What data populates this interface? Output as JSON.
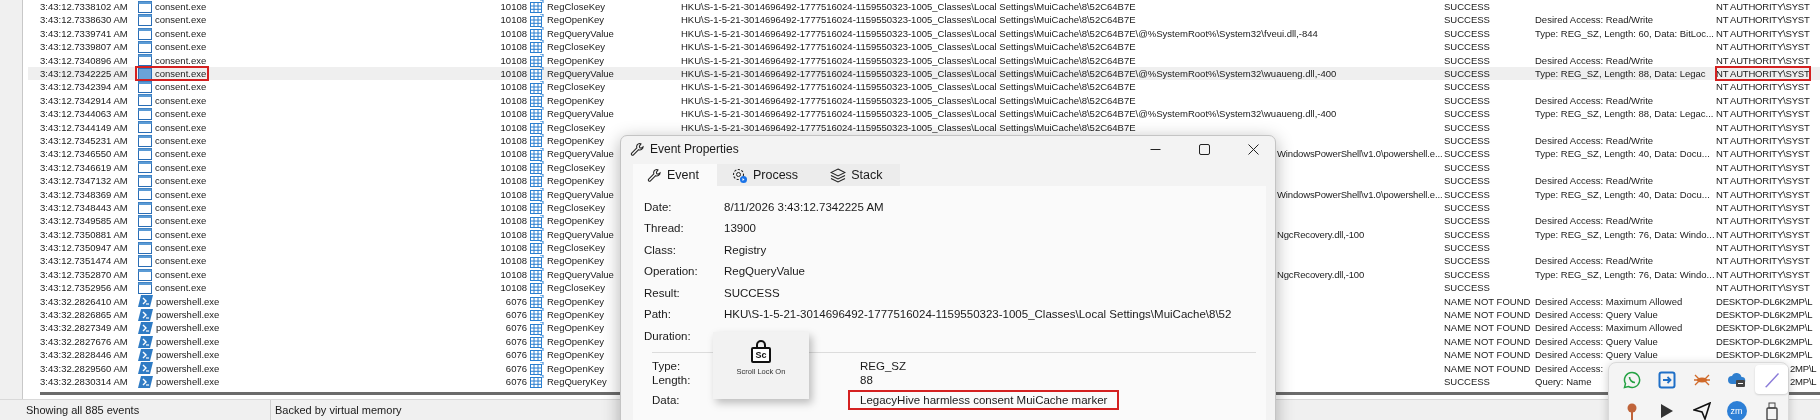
{
  "rows": [
    {
      "time": "3:43:12.7338102 AM",
      "kind": "gui",
      "process": "consent.exe",
      "pid": "10108",
      "operation": "RegCloseKey",
      "path": "HKU\\S-1-5-21-3014696492-1777516024-1159550323-1005_Classes\\Local Settings\\MuiCache\\8\\52C64B7E",
      "result": "SUCCESS",
      "user": "NT AUTHORITY\\SYST",
      "selected": false
    },
    {
      "time": "3:43:12.7338630 AM",
      "kind": "gui",
      "process": "consent.exe",
      "pid": "10108",
      "operation": "RegOpenKey",
      "path": "HKU\\S-1-5-21-3014696492-1777516024-1159550323-1005_Classes\\Local Settings\\MuiCache\\8\\52C64B7E",
      "result": "SUCCESS",
      "detail": "Desired Access: Read/Write",
      "user": "NT AUTHORITY\\SYST",
      "selected": false
    },
    {
      "time": "3:43:12.7339741 AM",
      "kind": "gui",
      "process": "consent.exe",
      "pid": "10108",
      "operation": "RegQueryValue",
      "path": "HKU\\S-1-5-21-3014696492-1777516024-1159550323-1005_Classes\\Local Settings\\MuiCache\\8\\52C64B7E\\@%SystemRoot%\\System32\\fveui.dll,-844",
      "result": "SUCCESS",
      "detail": "Type: REG_SZ, Length: 60, Data: BitLoc...",
      "user": "NT AUTHORITY\\SYST",
      "selected": false
    },
    {
      "time": "3:43:12.7339807 AM",
      "kind": "gui",
      "process": "consent.exe",
      "pid": "10108",
      "operation": "RegCloseKey",
      "path": "HKU\\S-1-5-21-3014696492-1777516024-1159550323-1005_Classes\\Local Settings\\MuiCache\\8\\52C64B7E",
      "result": "SUCCESS",
      "user": "NT AUTHORITY\\SYST",
      "selected": false
    },
    {
      "time": "3:43:12.7340896 AM",
      "kind": "gui",
      "process": "consent.exe",
      "pid": "10108",
      "operation": "RegOpenKey",
      "path": "HKU\\S-1-5-21-3014696492-1777516024-1159550323-1005_Classes\\Local Settings\\MuiCache\\8\\52C64B7E",
      "result": "SUCCESS",
      "detail": "Desired Access: Read/Write",
      "user": "NT AUTHORITY\\SYST",
      "selected": false
    },
    {
      "time": "3:43:12.7342225 AM",
      "kind": "gui",
      "process": "consent.exe",
      "pid": "10108",
      "operation": "RegQueryValue",
      "path": "HKU\\S-1-5-21-3014696492-1777516024-1159550323-1005_Classes\\Local Settings\\MuiCache\\8\\52C64B7E\\@%SystemRoot%\\System32\\wuaueng.dll,-400",
      "result": "SUCCESS",
      "detail": "Type: REG_SZ, Length: 88, Data: Legac",
      "user": "NT AUTHORITY\\SYST",
      "selected": true,
      "process_highlighted": true,
      "user_highlighted": true
    },
    {
      "time": "3:43:12.7342394 AM",
      "kind": "gui",
      "process": "consent.exe",
      "pid": "10108",
      "operation": "RegCloseKey",
      "path": "HKU\\S-1-5-21-3014696492-1777516024-1159550323-1005_Classes\\Local Settings\\MuiCache\\8\\52C64B7E",
      "result": "SUCCESS",
      "user": "NT AUTHORITY\\SYST",
      "selected": false
    },
    {
      "time": "3:43:12.7342914 AM",
      "kind": "gui",
      "process": "consent.exe",
      "pid": "10108",
      "operation": "RegOpenKey",
      "path": "HKU\\S-1-5-21-3014696492-1777516024-1159550323-1005_Classes\\Local Settings\\MuiCache\\8\\52C64B7E",
      "result": "SUCCESS",
      "detail": "Desired Access: Read/Write",
      "user": "NT AUTHORITY\\SYST",
      "selected": false
    },
    {
      "time": "3:43:12.7344063 AM",
      "kind": "gui",
      "process": "consent.exe",
      "pid": "10108",
      "operation": "RegQueryValue",
      "path": "HKU\\S-1-5-21-3014696492-1777516024-1159550323-1005_Classes\\Local Settings\\MuiCache\\8\\52C64B7E\\@%SystemRoot%\\System32\\wuaueng.dll,-400",
      "result": "SUCCESS",
      "detail": "Type: REG_SZ, Length: 88, Data: Legac...",
      "user": "NT AUTHORITY\\SYST",
      "selected": false
    },
    {
      "time": "3:43:12.7344149 AM",
      "kind": "gui",
      "process": "consent.exe",
      "pid": "10108",
      "operation": "RegCloseKey",
      "path": "HKU\\S-1-5-21-3014696492-1777516024-1159550323-1005_Classes\\Local Settings\\MuiCache\\8\\52C64B7E",
      "result": "SUCCESS",
      "user": "NT AUTHORITY\\SYST",
      "selected": false
    },
    {
      "time": "3:43:12.7345231 AM",
      "kind": "gui",
      "process": "consent.exe",
      "pid": "10108",
      "operation": "RegOpenKey",
      "result": "SUCCESS",
      "detail": "Desired Access: Read/Write",
      "user": "NT AUTHORITY\\SYST",
      "selected": false
    },
    {
      "time": "3:43:12.7346550 AM",
      "kind": "gui",
      "process": "consent.exe",
      "pid": "10108",
      "operation": "RegQueryValue",
      "path": "WindowsPowerShell\\v1.0\\powershell.e...",
      "result": "SUCCESS",
      "detail": "Type: REG_SZ, Length: 40, Data: Docu...",
      "user": "NT AUTHORITY\\SYST",
      "selected": false
    },
    {
      "time": "3:43:12.7346619 AM",
      "kind": "gui",
      "process": "consent.exe",
      "pid": "10108",
      "operation": "RegCloseKey",
      "result": "SUCCESS",
      "user": "NT AUTHORITY\\SYST",
      "selected": false
    },
    {
      "time": "3:43:12.7347132 AM",
      "kind": "gui",
      "process": "consent.exe",
      "pid": "10108",
      "operation": "RegOpenKey",
      "result": "SUCCESS",
      "detail": "Desired Access: Read/Write",
      "user": "NT AUTHORITY\\SYST",
      "selected": false
    },
    {
      "time": "3:43:12.7348369 AM",
      "kind": "gui",
      "process": "consent.exe",
      "pid": "10108",
      "operation": "RegQueryValue",
      "path": "WindowsPowerShell\\v1.0\\powershell.e...",
      "result": "SUCCESS",
      "detail": "Type: REG_SZ, Length: 40, Data: Docu...",
      "user": "NT AUTHORITY\\SYST",
      "selected": false
    },
    {
      "time": "3:43:12.7348443 AM",
      "kind": "gui",
      "process": "consent.exe",
      "pid": "10108",
      "operation": "RegCloseKey",
      "result": "SUCCESS",
      "user": "NT AUTHORITY\\SYST",
      "selected": false
    },
    {
      "time": "3:43:12.7349585 AM",
      "kind": "gui",
      "process": "consent.exe",
      "pid": "10108",
      "operation": "RegOpenKey",
      "result": "SUCCESS",
      "detail": "Desired Access: Read/Write",
      "user": "NT AUTHORITY\\SYST",
      "selected": false
    },
    {
      "time": "3:43:12.7350881 AM",
      "kind": "gui",
      "process": "consent.exe",
      "pid": "10108",
      "operation": "RegQueryValue",
      "path": "NgcRecovery.dll,-100",
      "result": "SUCCESS",
      "detail": "Type: REG_SZ, Length: 76, Data: Windo...",
      "user": "NT AUTHORITY\\SYST",
      "selected": false
    },
    {
      "time": "3:43:12.7350947 AM",
      "kind": "gui",
      "process": "consent.exe",
      "pid": "10108",
      "operation": "RegCloseKey",
      "result": "SUCCESS",
      "user": "NT AUTHORITY\\SYST",
      "selected": false
    },
    {
      "time": "3:43:12.7351474 AM",
      "kind": "gui",
      "process": "consent.exe",
      "pid": "10108",
      "operation": "RegOpenKey",
      "result": "SUCCESS",
      "detail": "Desired Access: Read/Write",
      "user": "NT AUTHORITY\\SYST",
      "selected": false
    },
    {
      "time": "3:43:12.7352870 AM",
      "kind": "gui",
      "process": "consent.exe",
      "pid": "10108",
      "operation": "RegQueryValue",
      "path": "NgcRecovery.dll,-100",
      "result": "SUCCESS",
      "detail": "Type: REG_SZ, Length: 76, Data: Windo...",
      "user": "NT AUTHORITY\\SYST",
      "selected": false
    },
    {
      "time": "3:43:12.7352956 AM",
      "kind": "gui",
      "process": "consent.exe",
      "pid": "10108",
      "operation": "RegCloseKey",
      "result": "SUCCESS",
      "user": "NT AUTHORITY\\SYST",
      "selected": false
    },
    {
      "time": "3:43:32.2826410 AM",
      "kind": "console",
      "process": "powershell.exe",
      "pid": "6076",
      "operation": "RegOpenKey",
      "result": "NAME NOT FOUND",
      "detail": "Desired Access: Maximum Allowed",
      "user": "DESKTOP-DL6K2MP\\L",
      "selected": false
    },
    {
      "time": "3:43:32.2826865 AM",
      "kind": "console",
      "process": "powershell.exe",
      "pid": "6076",
      "operation": "RegOpenKey",
      "result": "NAME NOT FOUND",
      "detail": "Desired Access: Query Value",
      "user": "DESKTOP-DL6K2MP\\L",
      "selected": false
    },
    {
      "time": "3:43:32.2827349 AM",
      "kind": "console",
      "process": "powershell.exe",
      "pid": "6076",
      "operation": "RegOpenKey",
      "result": "NAME NOT FOUND",
      "detail": "Desired Access: Maximum Allowed",
      "user": "DESKTOP-DL6K2MP\\L",
      "selected": false
    },
    {
      "time": "3:43:32.2827676 AM",
      "kind": "console",
      "process": "powershell.exe",
      "pid": "6076",
      "operation": "RegOpenKey",
      "result": "NAME NOT FOUND",
      "detail": "Desired Access: Query Value",
      "user": "DESKTOP-DL6K2MP\\L",
      "selected": false
    },
    {
      "time": "3:43:32.2828446 AM",
      "kind": "console",
      "process": "powershell.exe",
      "pid": "6076",
      "operation": "RegOpenKey",
      "result": "NAME NOT FOUND",
      "detail": "Desired Access: Query Value",
      "user": "DESKTOP-DL6K2MP\\L",
      "selected": false
    },
    {
      "time": "3:43:32.2829560 AM",
      "kind": "console",
      "process": "powershell.exe",
      "pid": "6076",
      "operation": "RegOpenKey",
      "result": "NAME NOT FOUND",
      "detail": "Desired Access:",
      "user": "2MP\\L",
      "selected": false
    },
    {
      "time": "3:43:32.2830314 AM",
      "kind": "console",
      "process": "powershell.exe",
      "pid": "6076",
      "operation": "RegQueryKey",
      "result": "SUCCESS",
      "detail": "Query: Name",
      "user": "2MP\\L",
      "selected": false
    }
  ],
  "status_bar": [
    "Showing all 885 events",
    "Backed by virtual memory"
  ],
  "dialog": {
    "title": "Event Properties",
    "tabs": [
      {
        "label": "Event",
        "kind": "wrench",
        "selected": true
      },
      {
        "label": "Process",
        "kind": "gear",
        "selected": false
      },
      {
        "label": "Stack",
        "kind": "layers",
        "selected": false
      }
    ],
    "fields": [
      {
        "label": "Date:",
        "value": "8/11/2026 3:43:12.7342225 AM"
      },
      {
        "label": "Thread:",
        "value": "13900"
      },
      {
        "label": "Class:",
        "value": "Registry"
      },
      {
        "label": "Operation:",
        "value": "RegQueryValue"
      },
      {
        "label": "Result:",
        "value": "SUCCESS"
      },
      {
        "label": "Path:",
        "value": "HKU\\S-1-5-21-3014696492-1777516024-1159550323-1005_Classes\\Local Settings\\MuiCache\\8\\52"
      },
      {
        "label": "Duration:"
      }
    ],
    "details": [
      {
        "label": "Type:",
        "value": "REG_SZ",
        "highlighted": false
      },
      {
        "label": "Length:",
        "value": "88",
        "highlighted": false
      },
      {
        "label": "Data:",
        "value": "LegacyHive harmless consent MuiCache marker",
        "highlighted": true
      }
    ]
  },
  "osd": {
    "key": "Sc",
    "text": "Scroll Lock On"
  },
  "tray": [
    {
      "kind": "chat",
      "selected": false
    },
    {
      "kind": "share",
      "selected": false
    },
    {
      "kind": "bug",
      "selected": false
    },
    {
      "kind": "cloud",
      "selected": false
    },
    {
      "kind": "pen",
      "selected": true
    },
    {
      "kind": "pin",
      "selected": false
    },
    {
      "kind": "play",
      "selected": false
    },
    {
      "kind": "plane",
      "selected": false
    },
    {
      "kind": "zoom",
      "label": "zm",
      "selected": false
    },
    {
      "kind": "usb",
      "selected": false
    }
  ]
}
